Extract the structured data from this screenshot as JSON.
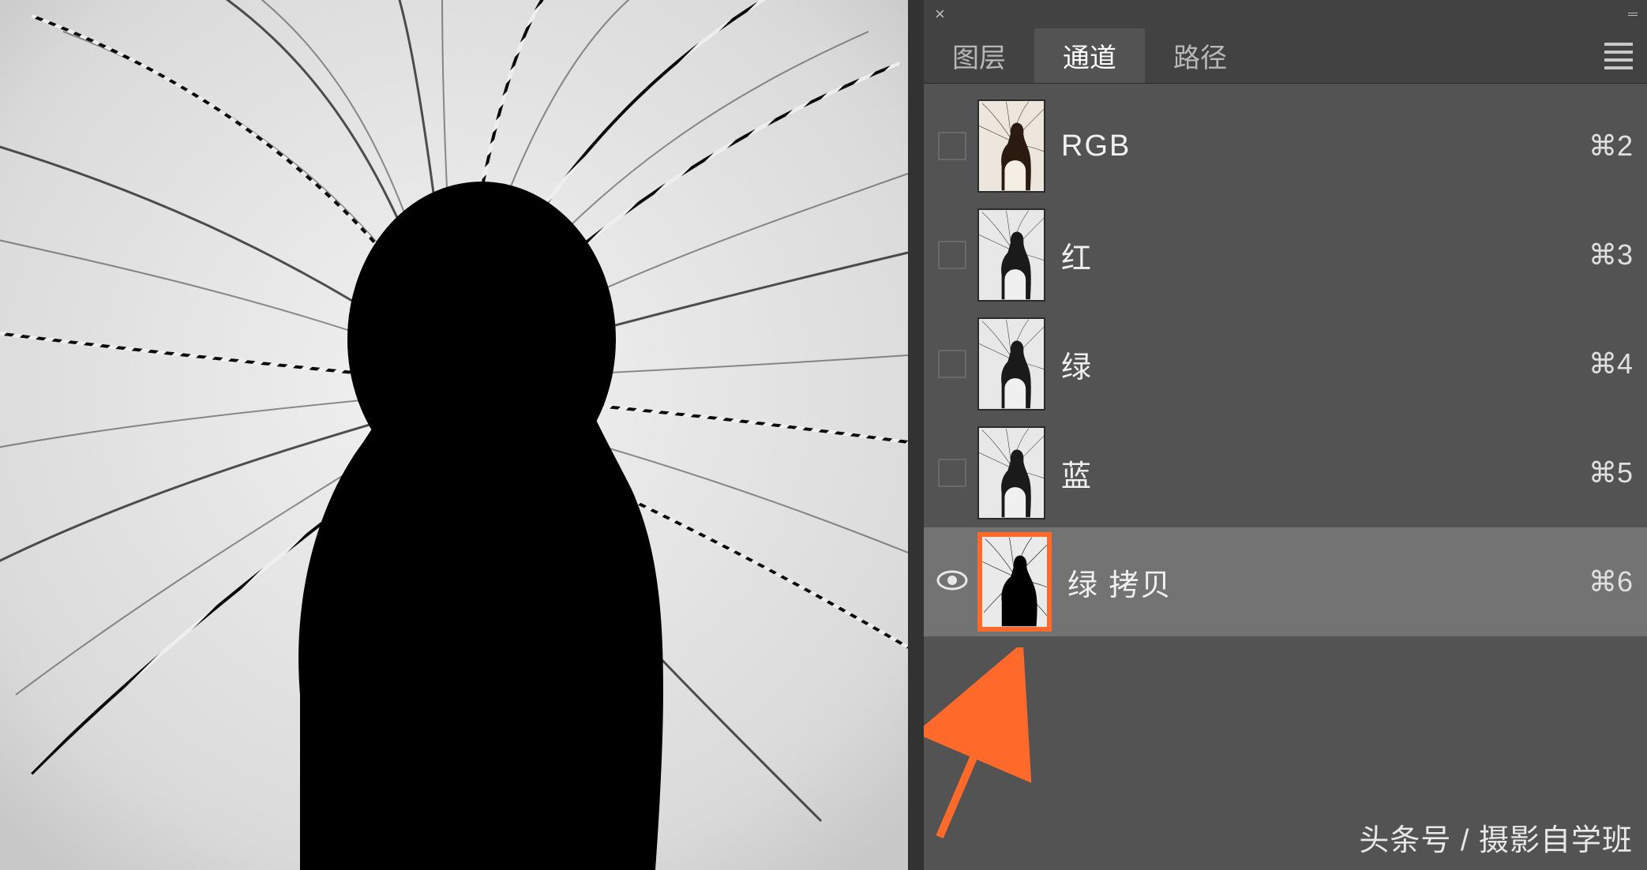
{
  "panel": {
    "tabs": {
      "layers": "图层",
      "channels": "通道",
      "paths": "路径"
    },
    "active_tab": "channels"
  },
  "channels": [
    {
      "name": "RGB",
      "shortcut": "⌘2",
      "visible": false,
      "selected": false,
      "thumb_style": "color"
    },
    {
      "name": "红",
      "shortcut": "⌘3",
      "visible": false,
      "selected": false,
      "thumb_style": "gray"
    },
    {
      "name": "绿",
      "shortcut": "⌘4",
      "visible": false,
      "selected": false,
      "thumb_style": "gray"
    },
    {
      "name": "蓝",
      "shortcut": "⌘5",
      "visible": false,
      "selected": false,
      "thumb_style": "gray"
    },
    {
      "name": "绿 拷贝",
      "shortcut": "⌘6",
      "visible": true,
      "selected": true,
      "thumb_style": "mask"
    }
  ],
  "watermark": "头条号 / 摄影自学班"
}
